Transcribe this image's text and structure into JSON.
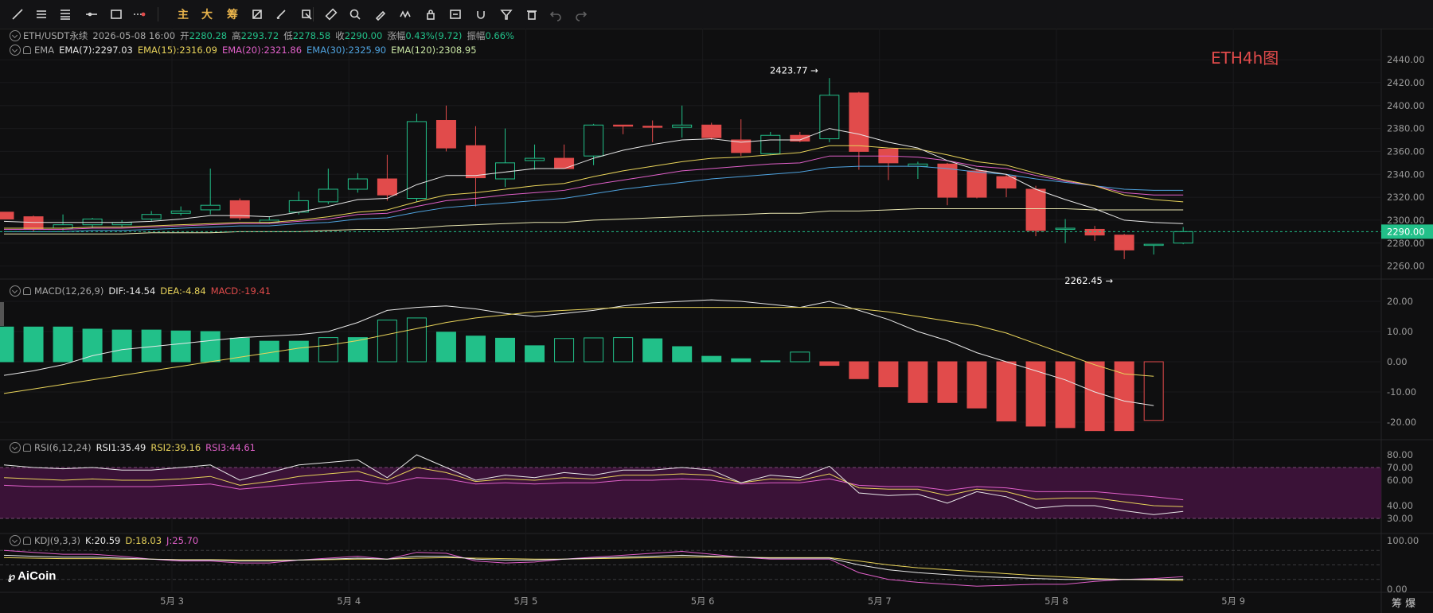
{
  "toolbar": {
    "icons": [
      "trendline-icon",
      "horizontal-lines-icon",
      "parallel-lines-icon",
      "ray-icon",
      "rectangle-icon",
      "dotted-line-icon",
      "text-main",
      "text-big",
      "text-chip",
      "crop-icon",
      "brush-icon",
      "cursor-icon",
      "ruler-icon",
      "zoom-icon",
      "pen-icon",
      "pattern-icon",
      "lock-icon",
      "note-icon",
      "magnet-icon",
      "filter-icon",
      "trash-icon",
      "undo-icon",
      "redo-icon"
    ],
    "text_main": "主",
    "text_big": "大",
    "text_chip": "筹"
  },
  "header": {
    "symbol": "ETH/USDT永续",
    "datetime": "2026-05-08 16:00",
    "open_label": "开",
    "open": "2280.28",
    "high_label": "高",
    "high": "2293.72",
    "low_label": "低",
    "low": "2278.58",
    "close_label": "收",
    "close": "2290.00",
    "change_label": "涨幅",
    "change": "0.43%(9.72)",
    "amp_label": "振幅",
    "amp": "0.66%"
  },
  "ema_legend": {
    "name": "EMA",
    "ema7": "EMA(7):2297.03",
    "ema15": "EMA(15):2316.09",
    "ema20": "EMA(20):2321.86",
    "ema30": "EMA(30):2325.90",
    "ema120": "EMA(120):2308.95"
  },
  "macd_legend": {
    "name": "MACD(12,26,9)",
    "dif": "DIF:-14.54",
    "dea": "DEA:-4.84",
    "macd": "MACD:-19.41"
  },
  "rsi_legend": {
    "name": "RSI(6,12,24)",
    "rsi1": "RSI1:35.49",
    "rsi2": "RSI2:39.16",
    "rsi3": "RSI3:44.61"
  },
  "kdj_legend": {
    "name": "KDJ(9,3,3)",
    "k": "K:20.59",
    "d": "D:18.03",
    "j": "J:25.70"
  },
  "watermark": "ETH4h图",
  "logo": "AiCoin",
  "bottom_toggle": "筹 爆",
  "colors": {
    "up": "#22c089",
    "down": "#e14b4b",
    "bg": "#0f0f10",
    "grid": "#1c1c1e",
    "rsi_band": "#3a1237"
  },
  "chart_data": [
    {
      "type": "candlestick",
      "title": "ETH/USDT永续 4h",
      "y_ticks": [
        2260,
        2280,
        2300,
        2320,
        2340,
        2360,
        2380,
        2400,
        2420,
        2440
      ],
      "ylim": [
        2250,
        2447
      ],
      "x_labels": [
        {
          "index": 5.7,
          "label": "5月 3"
        },
        {
          "index": 11.7,
          "label": "5月 4"
        },
        {
          "index": 17.7,
          "label": "5月 5"
        },
        {
          "index": 23.7,
          "label": "5月 6"
        },
        {
          "index": 29.7,
          "label": "5月 7"
        },
        {
          "index": 35.7,
          "label": "5月 8"
        },
        {
          "index": 41.7,
          "label": "5月 9"
        }
      ],
      "candles": [
        [
          2307,
          2305,
          2302,
          2301
        ],
        [
          2303,
          2304,
          2290,
          2292
        ],
        [
          2293,
          2305,
          2291,
          2296
        ],
        [
          2296,
          2302,
          2293,
          2301
        ],
        [
          2296,
          2300,
          2294,
          2298
        ],
        [
          2301,
          2308,
          2299,
          2305
        ],
        [
          2306,
          2312,
          2304,
          2308
        ],
        [
          2309,
          2345,
          2305,
          2313
        ],
        [
          2317,
          2319,
          2300,
          2302
        ],
        [
          2298,
          2303,
          2297,
          2300
        ],
        [
          2307,
          2325,
          2305,
          2317
        ],
        [
          2316,
          2345,
          2314,
          2327
        ],
        [
          2327,
          2341,
          2324,
          2336
        ],
        [
          2336,
          2357,
          2317,
          2322
        ],
        [
          2319,
          2393,
          2316,
          2386
        ],
        [
          2387,
          2400,
          2360,
          2363
        ],
        [
          2365,
          2382,
          2312,
          2337
        ],
        [
          2336,
          2380,
          2329,
          2350
        ],
        [
          2352,
          2366,
          2344,
          2354
        ],
        [
          2354,
          2366,
          2346,
          2345
        ],
        [
          2356,
          2384,
          2348,
          2383
        ],
        [
          2383,
          2383,
          2375,
          2382
        ],
        [
          2382,
          2387,
          2368,
          2381
        ],
        [
          2381,
          2400,
          2372,
          2383
        ],
        [
          2383,
          2385,
          2370,
          2372
        ],
        [
          2370,
          2388,
          2356,
          2359
        ],
        [
          2358,
          2377,
          2357,
          2374
        ],
        [
          2374,
          2377,
          2368,
          2369
        ],
        [
          2371,
          2424,
          2368,
          2409
        ],
        [
          2411,
          2412,
          2344,
          2360
        ],
        [
          2362,
          2362,
          2335,
          2350
        ],
        [
          2347,
          2351,
          2336,
          2349
        ],
        [
          2349,
          2350,
          2313,
          2320
        ],
        [
          2343,
          2345,
          2319,
          2320
        ],
        [
          2338,
          2340,
          2320,
          2328
        ],
        [
          2327,
          2330,
          2286,
          2291
        ],
        [
          2292,
          2301,
          2280,
          2293
        ],
        [
          2292,
          2295,
          2282,
          2287
        ],
        [
          2287,
          2288,
          2266,
          2274
        ],
        [
          2278,
          2279,
          2270,
          2279
        ],
        [
          2280,
          2294,
          2279,
          2290
        ]
      ],
      "ema7": [
        2299,
        2298,
        2298,
        2298,
        2298,
        2299,
        2301,
        2304,
        2304,
        2303,
        2307,
        2312,
        2318,
        2319,
        2331,
        2339,
        2339,
        2342,
        2345,
        2345,
        2354,
        2361,
        2366,
        2370,
        2371,
        2368,
        2370,
        2370,
        2380,
        2375,
        2368,
        2363,
        2352,
        2344,
        2340,
        2327,
        2318,
        2310,
        2300,
        2298,
        2297
      ],
      "ema15": [
        2293,
        2293,
        2293,
        2294,
        2294,
        2295,
        2296,
        2297,
        2298,
        2298,
        2300,
        2303,
        2307,
        2309,
        2316,
        2322,
        2324,
        2327,
        2330,
        2332,
        2338,
        2343,
        2347,
        2351,
        2354,
        2355,
        2357,
        2359,
        2365,
        2365,
        2363,
        2362,
        2357,
        2351,
        2348,
        2341,
        2335,
        2330,
        2322,
        2318,
        2316
      ],
      "ema20": [
        2292,
        2292,
        2292,
        2293,
        2293,
        2294,
        2295,
        2296,
        2297,
        2297,
        2299,
        2301,
        2305,
        2306,
        2312,
        2317,
        2319,
        2322,
        2324,
        2326,
        2331,
        2335,
        2339,
        2343,
        2345,
        2347,
        2349,
        2350,
        2356,
        2356,
        2356,
        2355,
        2352,
        2347,
        2345,
        2339,
        2334,
        2330,
        2324,
        2322,
        2322
      ],
      "ema30": [
        2290,
        2290,
        2290,
        2291,
        2291,
        2292,
        2293,
        2294,
        2295,
        2295,
        2297,
        2298,
        2301,
        2302,
        2307,
        2311,
        2313,
        2315,
        2317,
        2319,
        2323,
        2327,
        2330,
        2333,
        2336,
        2338,
        2340,
        2342,
        2346,
        2347,
        2347,
        2347,
        2345,
        2342,
        2340,
        2336,
        2333,
        2330,
        2327,
        2326,
        2326
      ],
      "ema120": [
        2288,
        2288,
        2288,
        2288,
        2288,
        2289,
        2289,
        2289,
        2290,
        2290,
        2290,
        2291,
        2292,
        2292,
        2293,
        2295,
        2296,
        2297,
        2298,
        2298,
        2300,
        2301,
        2302,
        2303,
        2304,
        2305,
        2306,
        2306,
        2308,
        2308,
        2309,
        2310,
        2310,
        2310,
        2310,
        2310,
        2310,
        2309,
        2309,
        2309,
        2309
      ],
      "marker_high": {
        "index": 28,
        "value": "2423.77"
      },
      "marker_low": {
        "index": 38,
        "value": "2262.45"
      },
      "last_price": "2290.00"
    },
    {
      "type": "bar",
      "title": "MACD(12,26,9)",
      "y_ticks": [
        -20,
        -10,
        0,
        10,
        20
      ],
      "ylim": [
        -25,
        25
      ],
      "hist": [
        11.5,
        11.5,
        11.5,
        10.8,
        10.5,
        10.5,
        10.2,
        10.0,
        7.8,
        6.8,
        6.8,
        8.0,
        8.0,
        13.8,
        14.5,
        9.8,
        8.5,
        7.8,
        5.3,
        7.7,
        7.9,
        8.0,
        7.6,
        5.0,
        1.8,
        1.0,
        0.3,
        3.2,
        -1.2,
        -5.6,
        -8.3,
        -13.5,
        -13.5,
        -15.3,
        -19.6,
        -21.3,
        -21.8,
        -22.8,
        -22.8,
        -19.4
      ],
      "hist_index_offset": 0,
      "dif": [
        -4.5,
        -3,
        -1,
        2,
        4,
        5,
        6,
        7,
        8,
        8.5,
        9,
        10,
        13,
        17,
        18,
        18.5,
        17.5,
        16,
        15,
        16,
        17,
        18.5,
        19.5,
        20,
        20.5,
        20,
        19,
        18,
        20,
        17,
        14,
        10,
        7,
        3,
        0,
        -3,
        -6,
        -10,
        -13,
        -14.5
      ],
      "dea": [
        -10.5,
        -9,
        -7.5,
        -6,
        -4.5,
        -3,
        -1.5,
        0,
        1.5,
        3,
        4.5,
        5.5,
        7,
        9,
        11,
        13,
        14.5,
        15.5,
        16.5,
        17,
        17.5,
        18,
        18,
        18,
        18,
        18,
        18,
        18,
        18,
        17.5,
        16.5,
        15,
        13.5,
        12,
        9.5,
        6,
        2.5,
        -1,
        -4,
        -4.8
      ]
    },
    {
      "type": "line",
      "title": "RSI(6,12,24)",
      "y_ticks": [
        30,
        40,
        60,
        70,
        80
      ],
      "ylim": [
        20,
        90
      ],
      "band": [
        30,
        70
      ],
      "rsi1": [
        72,
        70,
        69,
        70,
        68,
        68,
        70,
        72,
        60,
        66,
        72,
        74,
        76,
        62,
        80,
        70,
        60,
        64,
        62,
        66,
        64,
        68,
        68,
        70,
        68,
        58,
        64,
        62,
        71,
        50,
        48,
        49,
        42,
        51,
        47,
        38,
        40,
        40,
        36,
        33,
        35.5
      ],
      "rsi2": [
        62,
        61,
        60,
        61,
        60,
        60,
        61,
        63,
        56,
        59,
        63,
        65,
        67,
        60,
        70,
        66,
        59,
        61,
        60,
        62,
        61,
        64,
        64,
        65,
        64,
        58,
        61,
        60,
        65,
        54,
        53,
        53,
        48,
        53,
        51,
        45,
        46,
        46,
        43,
        40,
        39.2
      ],
      "rsi3": [
        56,
        55,
        55,
        55,
        55,
        55,
        56,
        57,
        53,
        55,
        57,
        59,
        60,
        57,
        62,
        61,
        57,
        58,
        57,
        58,
        58,
        60,
        60,
        61,
        60,
        57,
        58,
        58,
        61,
        56,
        55,
        55,
        52,
        55,
        54,
        51,
        51,
        51,
        49,
        47,
        44.6
      ]
    },
    {
      "type": "line",
      "title": "KDJ(9,3,3)",
      "y_ticks": [
        0,
        100
      ],
      "ylim": [
        -5,
        110
      ],
      "k": [
        70,
        68,
        66,
        66,
        64,
        62,
        60,
        60,
        58,
        58,
        60,
        62,
        64,
        62,
        68,
        68,
        62,
        60,
        60,
        62,
        64,
        66,
        68,
        70,
        68,
        66,
        64,
        64,
        64,
        50,
        40,
        34,
        30,
        26,
        24,
        22,
        20,
        20,
        20,
        20,
        20.6
      ],
      "d": [
        65,
        64,
        63,
        63,
        62,
        62,
        61,
        61,
        60,
        60,
        60,
        61,
        62,
        62,
        64,
        65,
        64,
        63,
        62,
        62,
        63,
        64,
        65,
        66,
        66,
        66,
        65,
        65,
        65,
        58,
        50,
        44,
        40,
        36,
        32,
        28,
        25,
        22,
        20,
        19,
        18.0
      ],
      "j": [
        80,
        76,
        72,
        72,
        68,
        62,
        58,
        58,
        54,
        54,
        60,
        64,
        68,
        62,
        76,
        74,
        58,
        54,
        56,
        62,
        66,
        70,
        74,
        78,
        72,
        66,
        62,
        62,
        62,
        34,
        20,
        14,
        10,
        6,
        8,
        10,
        10,
        16,
        20,
        22,
        25.7
      ]
    }
  ]
}
